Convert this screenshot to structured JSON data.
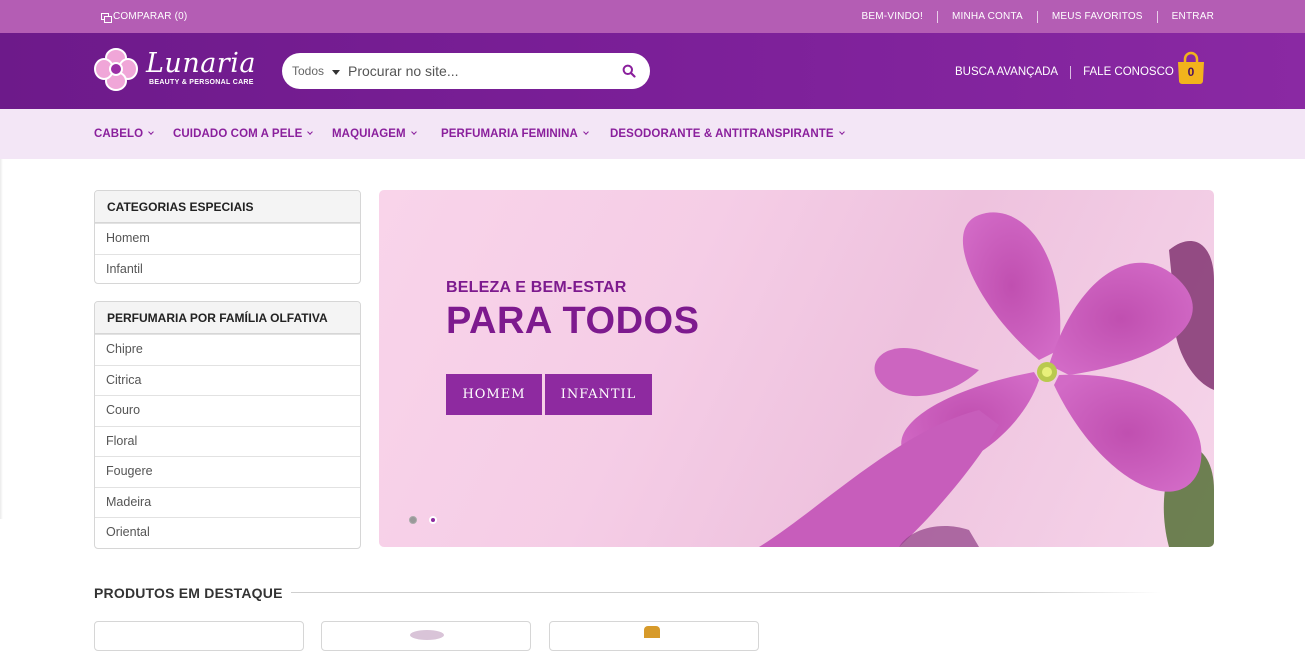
{
  "topbar": {
    "compare_label": "COMPARAR (0)",
    "links": [
      "BEM-VINDO!",
      "MINHA CONTA",
      "MEUS FAVORITOS",
      "ENTRAR"
    ]
  },
  "header": {
    "brand": "Lunaria",
    "tagline": "BEAUTY & PERSONAL CARE",
    "search": {
      "category": "Todos",
      "placeholder": "Procurar no site..."
    },
    "links": [
      "BUSCA AVANÇADA",
      "FALE CONOSCO"
    ],
    "cart_count": "0"
  },
  "nav": {
    "items": [
      "CABELO",
      "CUIDADO COM A PELE",
      "MAQUIAGEM",
      "PERFUMARIA FEMININA",
      "DESODORANTE & ANTITRANSPIRANTE"
    ]
  },
  "sidebar": {
    "special": {
      "title": "CATEGORIAS ESPECIAIS",
      "items": [
        "Homem",
        "Infantil"
      ]
    },
    "olfactory": {
      "title": "PERFUMARIA POR FAMÍLIA OLFATIVA",
      "items": [
        "Chipre",
        "Citrica",
        "Couro",
        "Floral",
        "Fougere",
        "Madeira",
        "Oriental"
      ]
    }
  },
  "banner": {
    "kicker": "BELEZA E BEM-ESTAR",
    "headline": "PARA TODOS",
    "buttons": [
      "HOMEM",
      "INFANTIL"
    ]
  },
  "featured": {
    "title": "PRODUTOS EM DESTAQUE"
  },
  "colors": {
    "topbar": "#b45db4",
    "header": "#7b1f98",
    "nav_bg": "#f3e6f6",
    "accent": "#8e2aa0",
    "cart": "#f2b31c"
  }
}
